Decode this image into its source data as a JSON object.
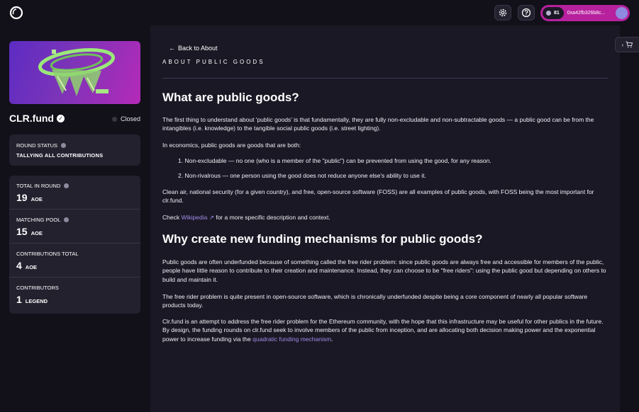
{
  "header": {
    "balance": "81",
    "address": "0xa42fb326b8c..."
  },
  "sidebar": {
    "round_name": "CLR.fund",
    "status": "Closed",
    "round_status_label": "Round status",
    "round_status_value": "TALLYING ALL CONTRIBUTIONS",
    "stats": [
      {
        "label": "Total in round",
        "value": "19",
        "unit": "AOE"
      },
      {
        "label": "Matching pool",
        "value": "15",
        "unit": "AOE"
      },
      {
        "label": "Contributions total",
        "value": "4",
        "unit": "AOE"
      },
      {
        "label": "Contributors",
        "value": "1",
        "unit": "LEGEND"
      }
    ]
  },
  "main": {
    "back_link": "Back to About",
    "section_title": "ABOUT PUBLIC GOODS",
    "h1_a": "What are public goods?",
    "p1": "The first thing to understand about 'public goods' is that fundamentally, they are fully non-excludable and non-subtractable goods — a public good can be from the intangibles (i.e. knowledge) to the tangible social public goods (i.e. street lighting).",
    "p2": "In economics, public goods are goods that are both:",
    "list": [
      "Non-excludable — no one (who is a member of the \"public\") can be prevented from using the good, for any reason.",
      "Non-rivalrous — one person using the good does not reduce anyone else's ability to use it."
    ],
    "p3": "Clean air, national security (for a given country), and free, open-source software (FOSS) are all examples of public goods, with FOSS being the most important for clr.fund.",
    "p4_prefix": "Check",
    "p4_link": "Wikipedia",
    "p4_suffix": "for a more specific description and context.",
    "h1_b": "Why create new funding mechanisms for public goods?",
    "p5": "Public goods are often underfunded because of something called the free rider problem: since public goods are always free and accessible for members of the public, people have little reason to contribute to their creation and maintenance. Instead, they can choose to be \"free riders\": using the public good but depending on others to build and maintain it.",
    "p6": "The free rider problem is quite present in open-source software, which is chronically underfunded despite being a core component of nearly all popular software products today.",
    "p7": "Clr.fund is an attempt to address the free rider problem for the Ethereum community, with the hope that this infrastructure may be useful for other publics in the future. By design, the funding rounds on clr.fund seek to involve members of the public from inception, and are allocating both decision making power and the exponential power to increase funding via the",
    "p7_link": "quadratic funding mechanism",
    "p7_end": "."
  }
}
